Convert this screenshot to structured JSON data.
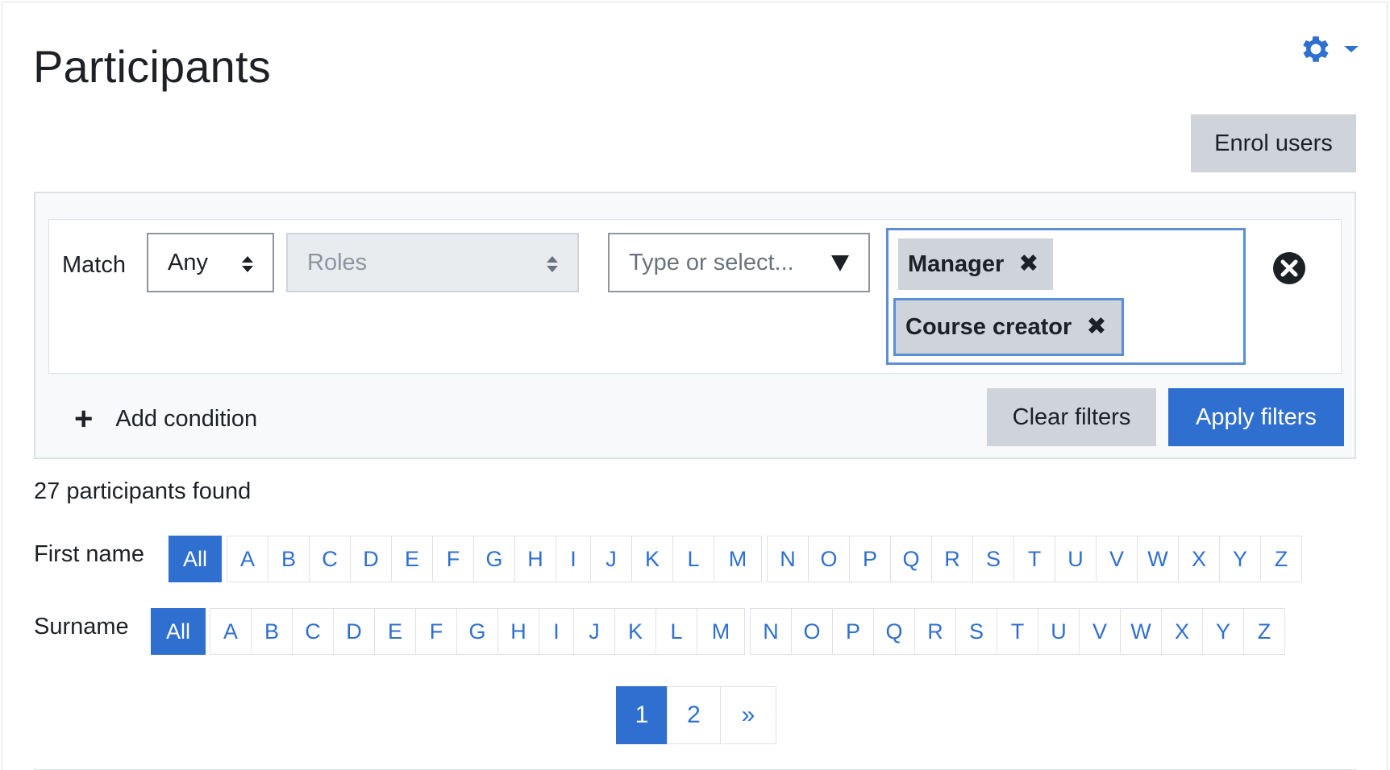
{
  "page": {
    "title": "Participants"
  },
  "header": {
    "settings_icon": "gear-icon",
    "accent_color": "#2f6fd0"
  },
  "actions": {
    "enrol_users": "Enrol users"
  },
  "filter": {
    "match_label": "Match",
    "match_value": "Any",
    "type_value": "Roles",
    "value_placeholder": "Type or select...",
    "selected": [
      {
        "label": "Manager",
        "remove": "✖"
      },
      {
        "label": "Course creator",
        "remove": "✖"
      }
    ],
    "add_condition": "Add condition",
    "clear_filters": "Clear filters",
    "apply_filters": "Apply filters"
  },
  "results": {
    "found_text": "27 participants found"
  },
  "initials": {
    "first_name_label": "First name",
    "surname_label": "Surname",
    "all_label": "All",
    "group1": [
      "A",
      "B",
      "C",
      "D",
      "E",
      "F",
      "G",
      "H",
      "I",
      "J",
      "K",
      "L",
      "M"
    ],
    "group2": [
      "N",
      "O",
      "P",
      "Q",
      "R",
      "S",
      "T",
      "U",
      "V",
      "W",
      "X",
      "Y",
      "Z"
    ]
  },
  "pagination": {
    "pages": [
      "1",
      "2"
    ],
    "current": "1",
    "next": "»"
  }
}
